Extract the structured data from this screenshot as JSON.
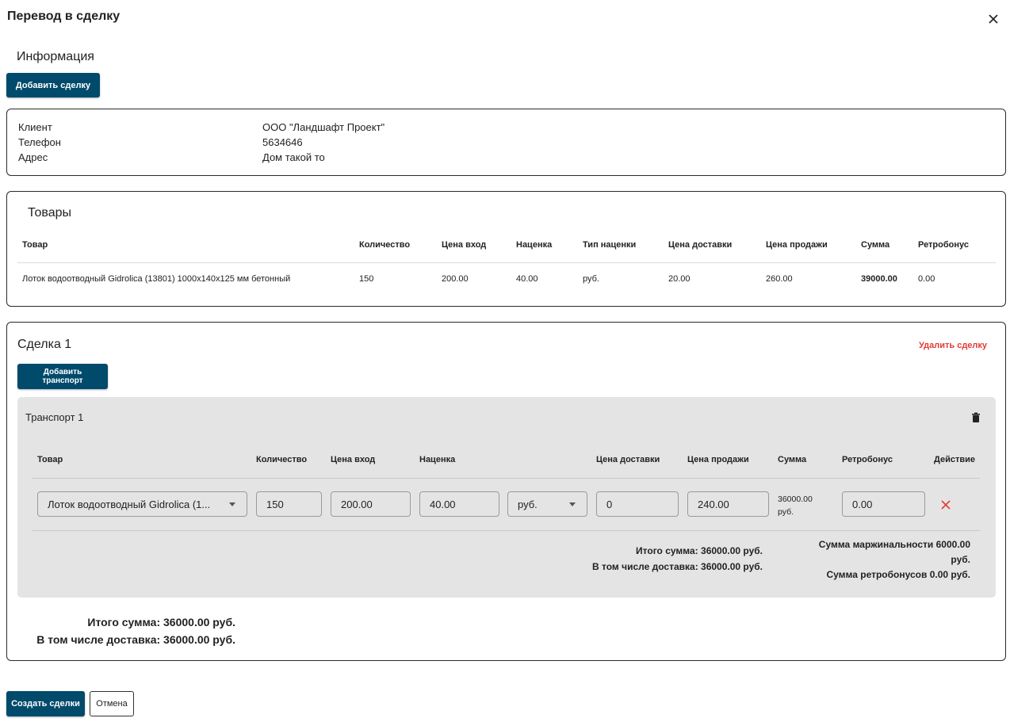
{
  "dialog": {
    "title": "Перевод в сделку"
  },
  "info": {
    "title": "Информация",
    "add_deal_label": "Добавить сделку",
    "rows": [
      {
        "label": "Клиент",
        "value": "ООО \"Ландшафт Проект\""
      },
      {
        "label": "Телефон",
        "value": "5634646"
      },
      {
        "label": "Адрес",
        "value": "Дом такой то"
      }
    ]
  },
  "goods": {
    "title": "Товары",
    "columns": [
      "Товар",
      "Количество",
      "Цена вход",
      "Наценка",
      "Тип наценки",
      "Цена доставки",
      "Цена продажи",
      "Сумма",
      "Ретробонус"
    ],
    "rows": [
      [
        "Лоток водоотводный Gidrolica (13801) 1000x140x125 мм бетонный",
        "150",
        "200.00",
        "40.00",
        "руб.",
        "20.00",
        "260.00",
        "39000.00",
        "0.00"
      ]
    ]
  },
  "deal": {
    "title": "Сделка 1",
    "delete_label": "Удалить сделку",
    "add_transport_label": "Добавить транспорт",
    "transport": {
      "title": "Транспорт 1",
      "columns": {
        "product": "Товар",
        "quantity": "Количество",
        "price_in": "Цена вход",
        "markup": "Наценка",
        "delivery": "Цена доставки",
        "sale_price": "Цена продажи",
        "sum": "Сумма",
        "retrobonus": "Ретробонус",
        "action": "Действие"
      },
      "row": {
        "product": "Лоток водоотводный Gidrolica (1...",
        "quantity": "150",
        "price_in": "200.00",
        "markup": "40.00",
        "markup_type": "руб.",
        "delivery": "0",
        "sale_price": "240.00",
        "sum_line1": "36000.00",
        "sum_line2": "руб.",
        "retrobonus": "0.00"
      },
      "total_sum": "Итого сумма: 36000.00 руб.",
      "delivery_included": "В том числе доставка: 36000.00 руб.",
      "margin_line1": "Сумма маржинальности 6000.00",
      "margin_line2": "руб.",
      "retro_sum": "Сумма ретробонусов 0.00 руб."
    },
    "total_sum": "Итого сумма: 36000.00 руб.",
    "delivery_included": "В том числе доставка: 36000.00 руб."
  },
  "footer": {
    "create_label": "Создать сделки",
    "cancel_label": "Отмена"
  },
  "colors": {
    "primary": "#004a6b",
    "danger": "#e53935",
    "panel": "#e4e4e4"
  }
}
